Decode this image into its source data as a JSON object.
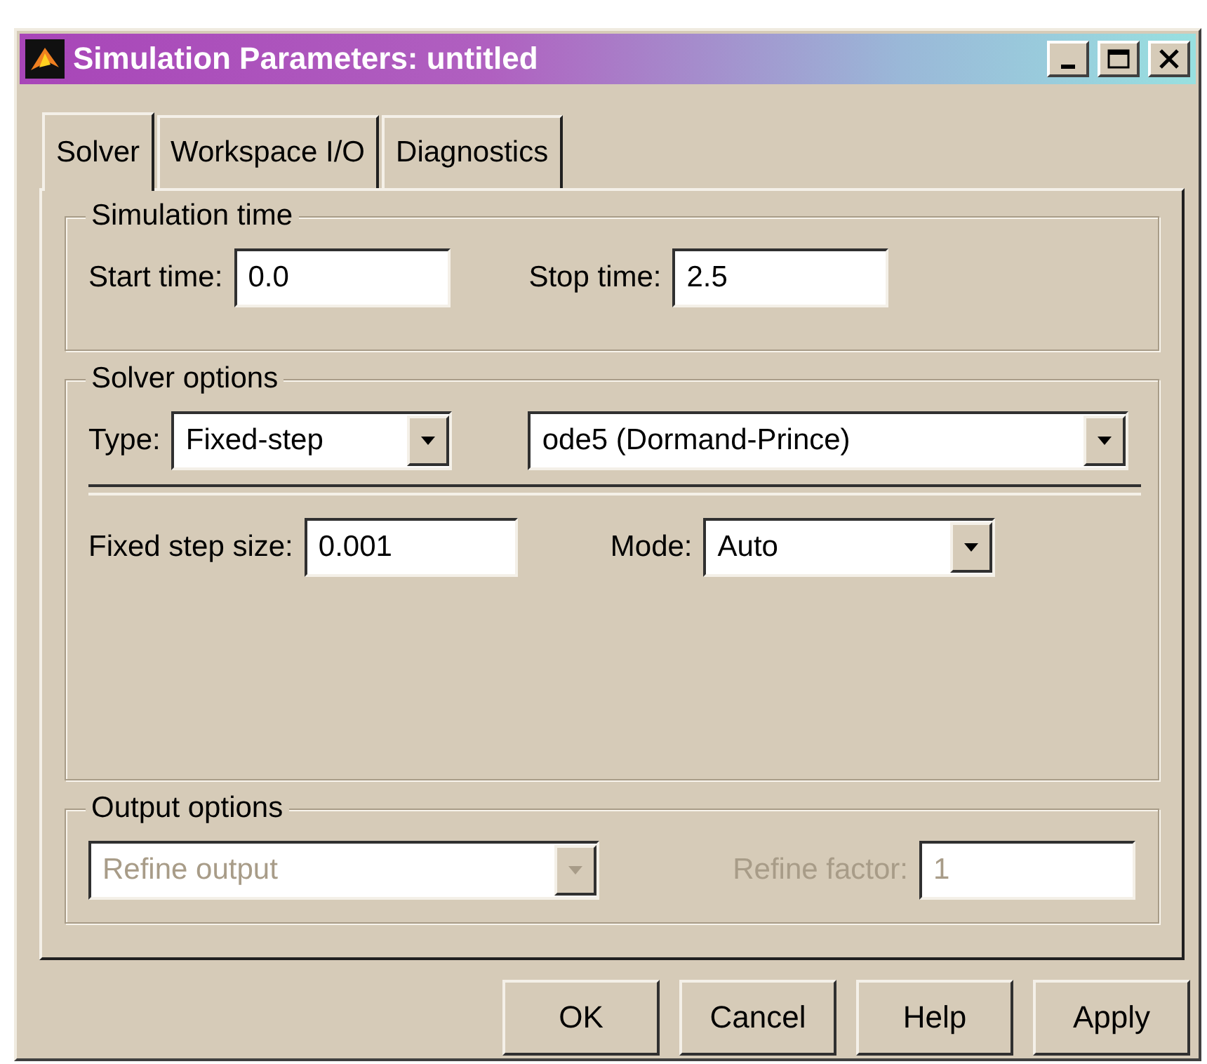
{
  "window": {
    "title": "Simulation Parameters: untitled"
  },
  "tabs": [
    {
      "label": "Solver",
      "selected": true
    },
    {
      "label": "Workspace I/O",
      "selected": false
    },
    {
      "label": "Diagnostics",
      "selected": false
    }
  ],
  "simulation_time": {
    "title": "Simulation time",
    "start_label": "Start time:",
    "start_value": "0.0",
    "stop_label": "Stop time:",
    "stop_value": "2.5"
  },
  "solver_options": {
    "title": "Solver options",
    "type_label": "Type:",
    "type_value": "Fixed-step",
    "solver_value": "ode5 (Dormand-Prince)",
    "step_label": "Fixed step size:",
    "step_value": "0.001",
    "mode_label": "Mode:",
    "mode_value": "Auto"
  },
  "output_options": {
    "title": "Output options",
    "disabled": true,
    "refine_value": "Refine output",
    "factor_label": "Refine factor:",
    "factor_value": "1"
  },
  "buttons": [
    "OK",
    "Cancel",
    "Help",
    "Apply"
  ]
}
